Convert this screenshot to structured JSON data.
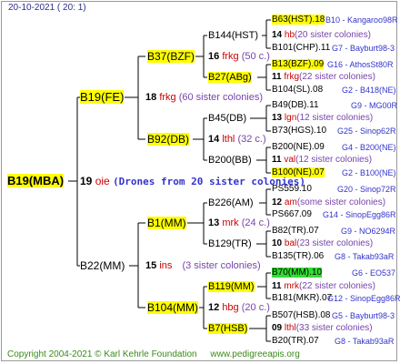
{
  "header": "20-10-2021 ( 20: 1)",
  "footer": {
    "copyright": "Copyright 2004-2021 © Karl Kehrle Foundation",
    "site": "www.pedigreeapis.org"
  },
  "root": {
    "name": "B19(MBA)"
  },
  "drones": {
    "num": "19",
    "code": "oie",
    "text": "(Drones from 20 sister colonies)"
  },
  "queen_line": {
    "mother": "B19(FE)",
    "gen2": {
      "num": "18",
      "code": "frkg",
      "note": "(60 sister colonies)"
    },
    "gm": "B37(BZF)",
    "gm_gen": {
      "num": "16",
      "code": "frkg",
      "note": "(50 c.)"
    },
    "ggm_top": "B144(HST)",
    "ggm_top_gen": {
      "num": "14",
      "code": "hb",
      "note": "(20 sister colonies)"
    },
    "ggm_bot": "B27(ABg)",
    "ggm_bot_gen": {
      "num": "11",
      "code": "frkg",
      "note": "(22 sister colonies)"
    },
    "b92": "B92(DB)",
    "b92_gen": {
      "num": "14",
      "code": "lthl",
      "note": "(32 c.)"
    },
    "b45": "B45(DB)",
    "b45_gen": {
      "num": "13",
      "code": "lgn",
      "note": "(12 sister colonies)"
    },
    "b200": "B200(BB)",
    "b200_gen": {
      "num": "11",
      "code": "val",
      "note": "(12 sister colonies)"
    }
  },
  "drone_line": {
    "father": "B22(MM)",
    "gen": {
      "num": "15",
      "code": "ins",
      "note": "(3 sister colonies)"
    },
    "b1": "B1(MM)",
    "b1_gen": {
      "num": "13",
      "code": "mrk",
      "note": "(24 c.)"
    },
    "b226": "B226(AM)",
    "b226_gen": {
      "num": "12",
      "code": "am",
      "note": "(some sister colonies)"
    },
    "b129": "B129(TR)",
    "b129_gen": {
      "num": "10",
      "code": "bal",
      "note": "(23 sister colonies)"
    },
    "b104": "B104(MM)",
    "b104_gen": {
      "num": "12",
      "code": "hbg",
      "note": "(20 c.)"
    },
    "b119": "B119(MM)",
    "b119_gen": {
      "num": "11",
      "code": "mrk",
      "note": "(22 sister colonies)"
    },
    "b7": "B7(HSB)",
    "b7_gen": {
      "num": "09",
      "code": "lthl",
      "note": "(33 sister colonies)"
    }
  },
  "right": [
    {
      "left": "B63(HST).18",
      "right": "B10 - Kangaroo98R"
    },
    {
      "left": "B101(CHP).11",
      "right": "G7 - Bayburt98-3"
    },
    {
      "left": "B13(BZF).09",
      "right": "G16 - AthosSt80R"
    },
    {
      "left": "B104(SL).08",
      "right": "G2 - B418(NE)"
    },
    {
      "left": "B49(DB).11",
      "right": "G9 - MG00R"
    },
    {
      "left": "B73(HGS).10",
      "right": "G25 - Sinop62R"
    },
    {
      "left": "B200(NE).09",
      "right": "G4 - B200(NE)"
    },
    {
      "left": "B100(NE).07",
      "right": "G2 - B100(NE)"
    },
    {
      "left": "PS559.10",
      "right": "G20 - Sinop72R"
    },
    {
      "left": "PS667.09",
      "right": "G14 - SinopEgg86R"
    },
    {
      "left": "B82(TR).07",
      "right": "G9 - NO6294R"
    },
    {
      "left": "B135(TR).06",
      "right": "G8 - Takab93aR"
    },
    {
      "left": "B70(MM).10",
      "right": "G6 - EO537"
    },
    {
      "left": "B181(MKR).07",
      "right": "G12 - SinopEgg86R"
    },
    {
      "left": "B507(HSB).08",
      "right": "G5 - Bayburt98-3"
    },
    {
      "left": "B20(TR).07",
      "right": "G8 - Takab93aR"
    }
  ],
  "colors": {
    "highlight": "#ffff00",
    "highlight_green": "#33dd33",
    "line": "#000000"
  }
}
